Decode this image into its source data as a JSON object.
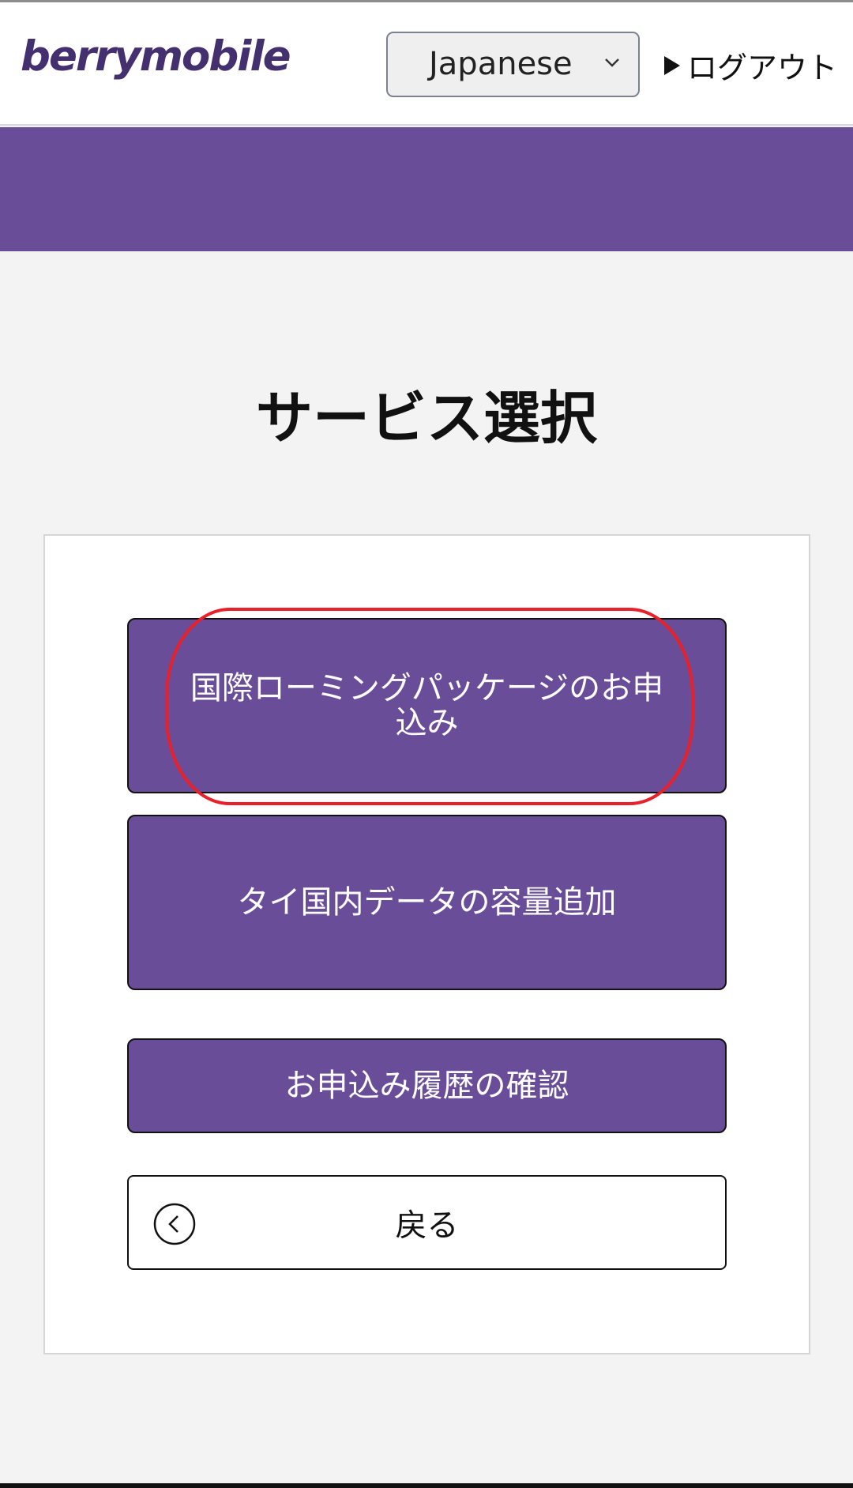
{
  "header": {
    "logo_text": "berrymobile",
    "language_select": {
      "value": "Japanese"
    },
    "logout_label": "ログアウト"
  },
  "main": {
    "title": "サービス選択",
    "buttons": {
      "roaming": "国際ローミングパッケージのお申込み",
      "data_add": "タイ国内データの容量追加",
      "history": "お申込み履歴の確認",
      "back": "戻る"
    }
  },
  "colors": {
    "brand_purple": "#6a4d99",
    "logo_color": "#45306f",
    "highlight_red": "#e8202a",
    "background": "#f3f3f3"
  },
  "icons": {
    "language_dropdown": "chevron-down-icon",
    "logout": "triangle-right-icon",
    "back": "chevron-left-circle-icon"
  }
}
